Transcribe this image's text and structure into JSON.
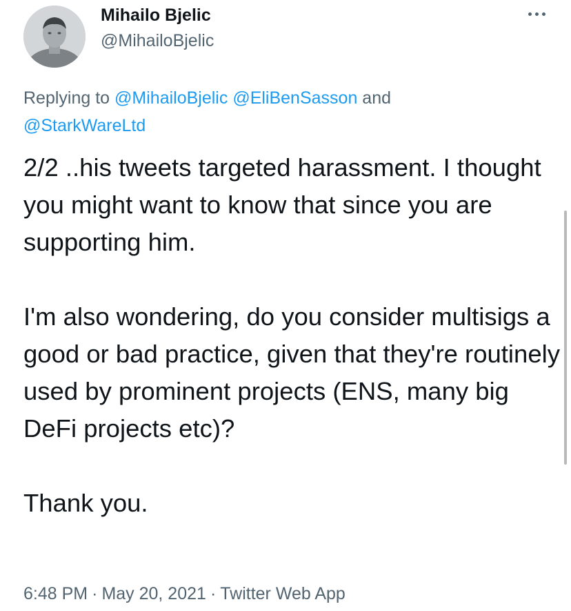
{
  "author": {
    "name": "Mihailo Bjelic",
    "handle": "@MihailoBjelic",
    "avatar_icon": "profile-photo"
  },
  "more_icon": "more-horizontal-icon",
  "reply": {
    "prefix": "Replying to ",
    "mention_1": "@MihailoBjelic",
    "mention_2": "@EliBenSasson",
    "conjunction": " and ",
    "mention_3": "@StarkWareLtd"
  },
  "tweet": {
    "paragraph_1": "2/2 ..his tweets targeted harassment. I thought you might want to know that since you are supporting him.",
    "paragraph_2": "I'm also wondering, do you consider multisigs a good or bad practice, given that they're routinely used by prominent projects (ENS, many big DeFi projects etc)?",
    "paragraph_3": "Thank you."
  },
  "meta": {
    "time": "6:48 PM",
    "separator": "·",
    "date": "May 20, 2021",
    "source": "Twitter Web App"
  },
  "colors": {
    "text": "#0f1419",
    "secondary": "#536471",
    "link": "#1d9bf0"
  }
}
